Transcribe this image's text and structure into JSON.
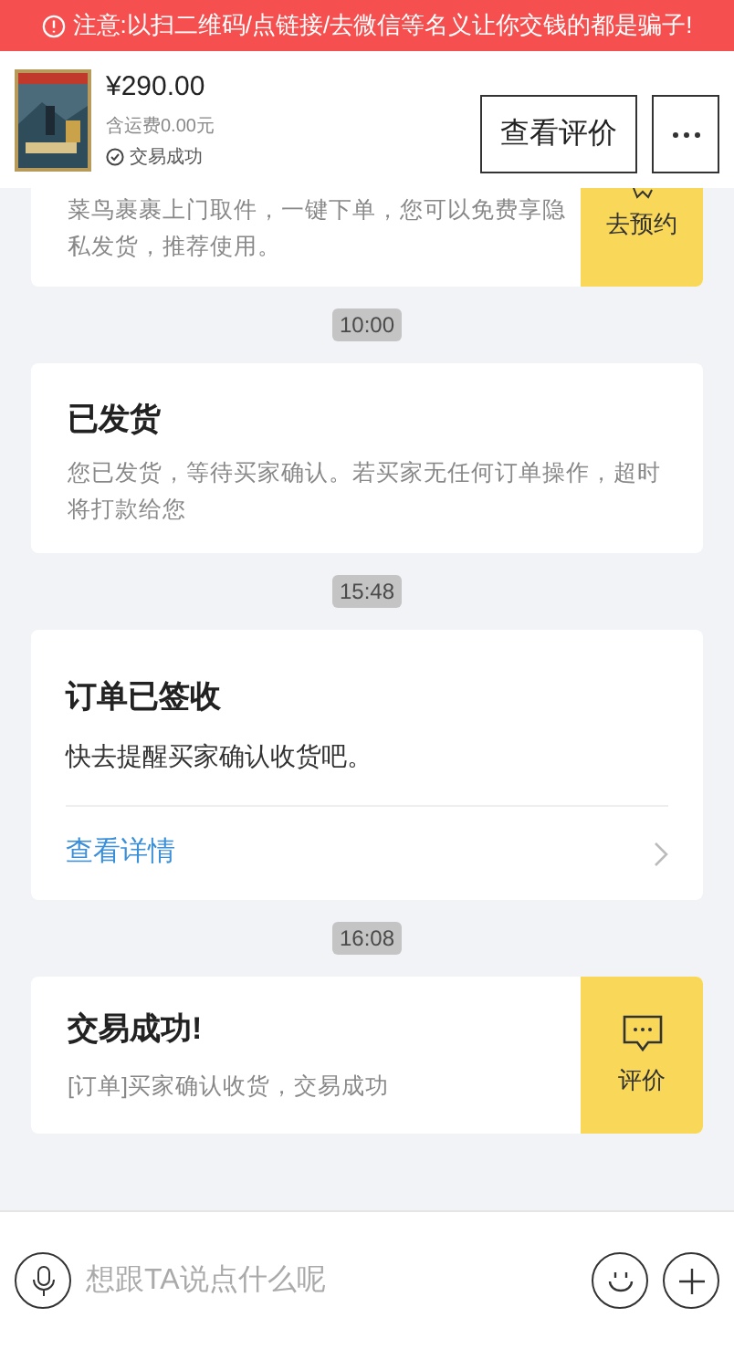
{
  "warning_banner": {
    "text": "注意:以扫二维码/点链接/去微信等名义让你交钱的都是骗子!"
  },
  "order_header": {
    "price": "¥290.00",
    "shipping": "含运费0.00元",
    "status": "交易成功",
    "buttons": [
      {
        "kind": "text",
        "label": "查看评价"
      },
      {
        "kind": "more"
      }
    ]
  },
  "messages": [
    {
      "kind": "card_action",
      "description": "菜鸟裹裹上门取件，一键下单，您可以免费享隐私发货，推荐使用。",
      "action": {
        "kind": "partial",
        "label": "去预约"
      },
      "cut_top": true
    },
    {
      "kind": "time",
      "text": "10:00"
    },
    {
      "kind": "card",
      "title": "已发货",
      "description": "您已发货，等待买家确认。若买家无任何订单操作，超时将打款给您"
    },
    {
      "kind": "time",
      "text": "15:48"
    },
    {
      "kind": "card_link",
      "title": "订单已签收",
      "description": "快去提醒买家确认收货吧。",
      "link": "查看详情"
    },
    {
      "kind": "time",
      "text": "16:08"
    },
    {
      "kind": "card_action",
      "title": "交易成功!",
      "description": "[订单]买家确认收货，交易成功",
      "action": {
        "kind": "chat",
        "label": "评价"
      },
      "cut_top": false
    }
  ],
  "input_bar": {
    "placeholder": "想跟TA说点什么呢"
  }
}
